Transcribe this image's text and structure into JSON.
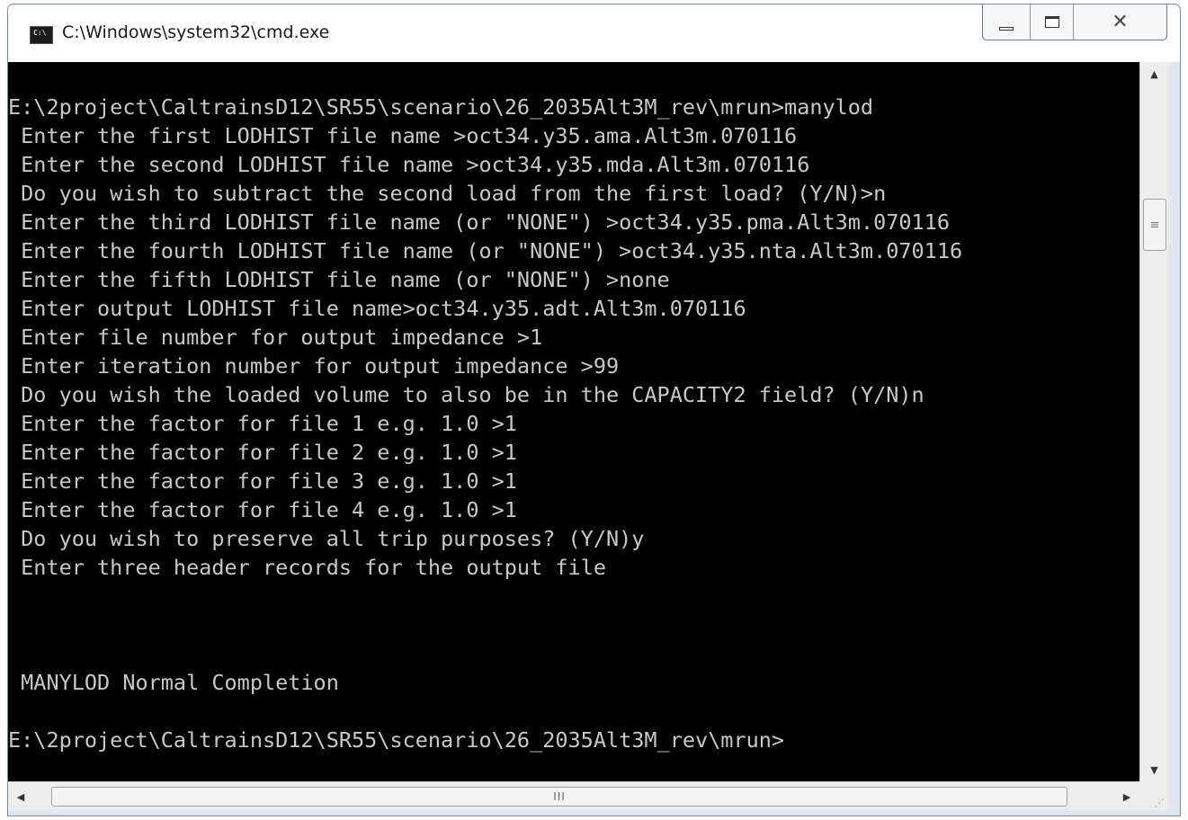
{
  "window": {
    "title": "C:\\Windows\\system32\\cmd.exe",
    "icon_text": "C:\\"
  },
  "caption_buttons": {
    "minimize_icon": "minimize-icon",
    "maximize_icon": "maximize-icon",
    "close_icon": "close-icon",
    "close_glyph": "✕"
  },
  "console": {
    "lines": [
      "E:\\2project\\CaltrainsD12\\SR55\\scenario\\26_2035Alt3M_rev\\mrun>manylod",
      " Enter the first LODHIST file name >oct34.y35.ama.Alt3m.070116",
      " Enter the second LODHIST file name >oct34.y35.mda.Alt3m.070116",
      " Do you wish to subtract the second load from the first load? (Y/N)>n",
      " Enter the third LODHIST file name (or \"NONE\") >oct34.y35.pma.Alt3m.070116",
      " Enter the fourth LODHIST file name (or \"NONE\") >oct34.y35.nta.Alt3m.070116",
      " Enter the fifth LODHIST file name (or \"NONE\") >none",
      " Enter output LODHIST file name>oct34.y35.adt.Alt3m.070116",
      " Enter file number for output impedance >1",
      " Enter iteration number for output impedance >99",
      " Do you wish the loaded volume to also be in the CAPACITY2 field? (Y/N)n",
      " Enter the factor for file 1 e.g. 1.0 >1",
      " Enter the factor for file 2 e.g. 1.0 >1",
      " Enter the factor for file 3 e.g. 1.0 >1",
      " Enter the factor for file 4 e.g. 1.0 >1",
      " Do you wish to preserve all trip purposes? (Y/N)y",
      " Enter three header records for the output file",
      "",
      "",
      "",
      " MANYLOD Normal Completion",
      "",
      "E:\\2project\\CaltrainsD12\\SR55\\scenario\\26_2035Alt3M_rev\\mrun>"
    ]
  },
  "scrollbars": {
    "up_arrow": "▲",
    "down_arrow": "▼",
    "left_arrow": "◀",
    "right_arrow": "▶",
    "v_thumb_grip": "≡",
    "h_thumb_grip": "III",
    "resize_grip": "⋰"
  },
  "colors": {
    "console_bg": "#000000",
    "console_text": "#c8c8c8",
    "chrome": "#dfe7f1"
  }
}
